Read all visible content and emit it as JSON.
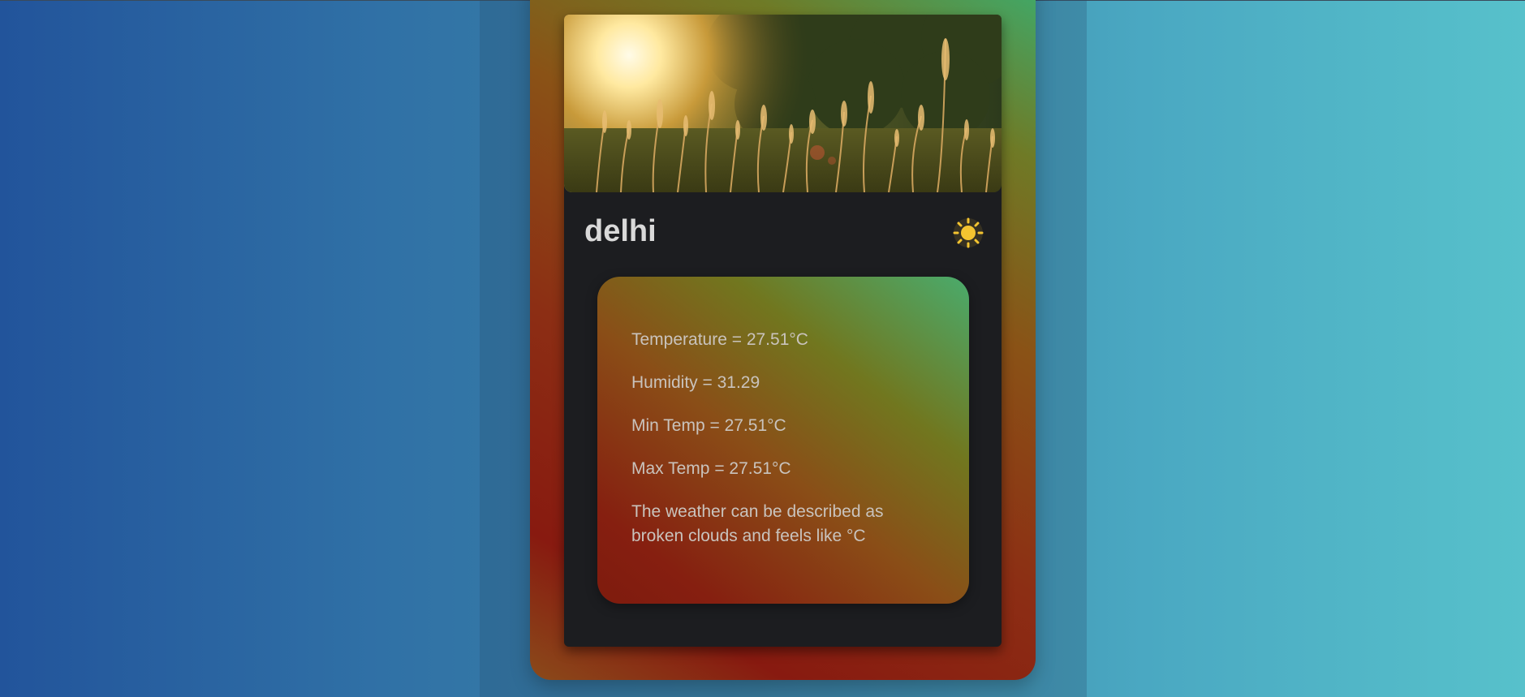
{
  "city": "delhi",
  "weather_icon": "sun-icon",
  "colors": {
    "background_start": "#22549b",
    "background_end": "#57c1cb",
    "card_bg": "#1c1d20",
    "sun": "#f4c430",
    "text": "#c9c3bd"
  },
  "details": {
    "temperature": "Temperature = 27.51°C",
    "humidity": "Humidity = 31.29",
    "min_temp": "Min Temp = 27.51°C",
    "max_temp": "Max Temp = 27.51°C",
    "description": "The weather can be described as broken clouds and feels like °C"
  }
}
